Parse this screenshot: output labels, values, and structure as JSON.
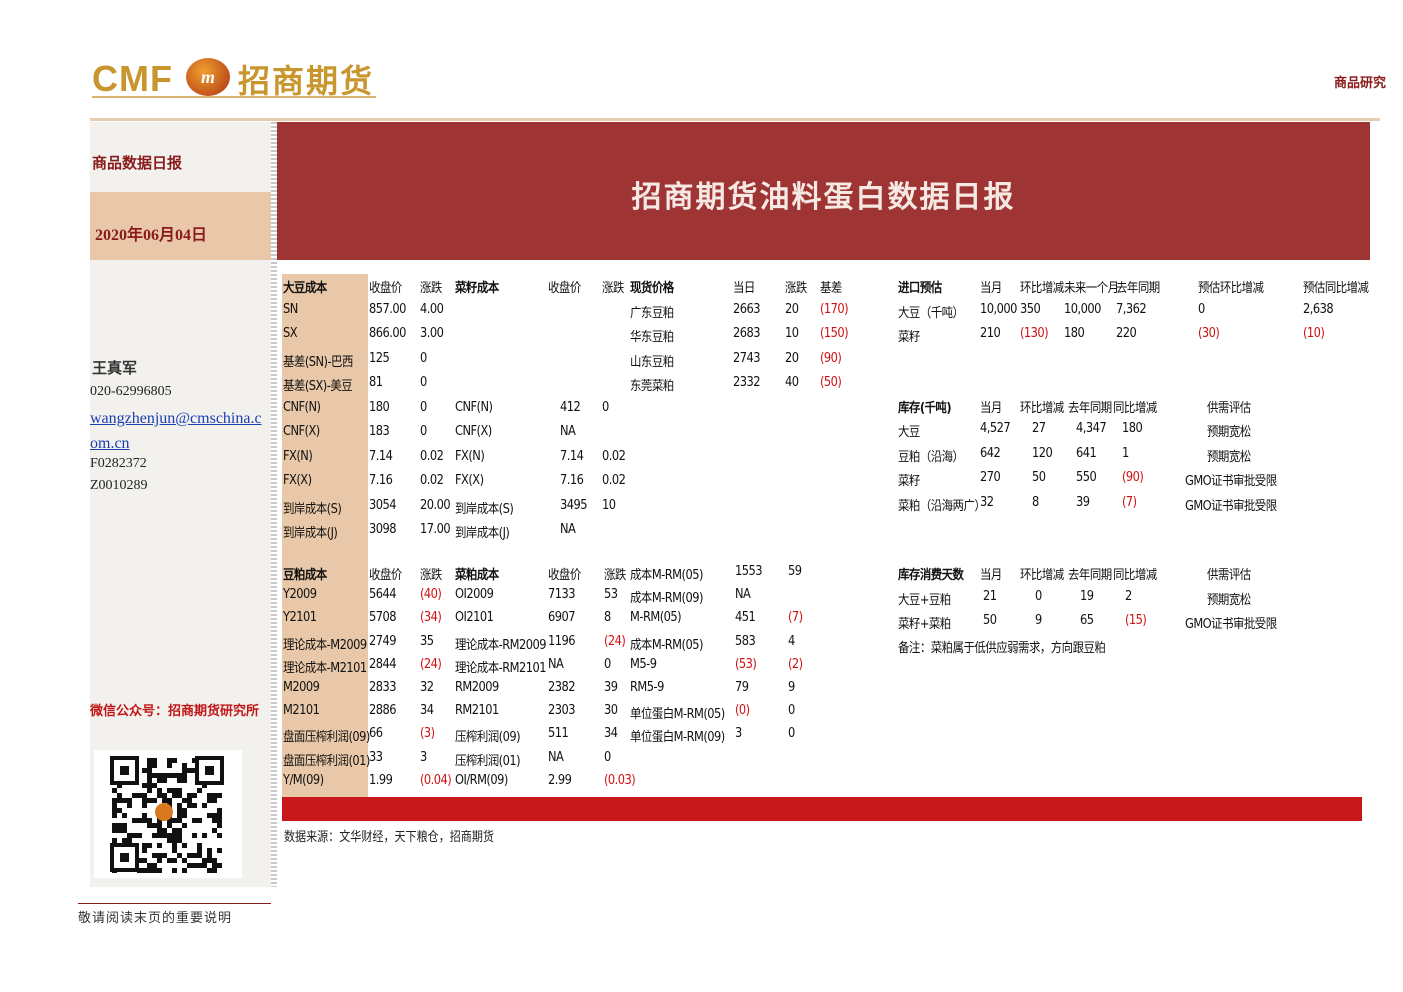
{
  "header": {
    "logo_latin": "CMF",
    "logo_chinese": "招商期货",
    "section": "商品研究"
  },
  "sidebar": {
    "report_type": "商品数据日报",
    "date": "2020年06月04日",
    "analyst_name": "王真军",
    "phone": "020-62996805",
    "email": "wangzhenjun@cmschina.com.cn",
    "license_1": "F0282372",
    "license_2": "Z0010289",
    "wechat": "微信公众号：招商期货研究所"
  },
  "banner": {
    "title": "招商期货油料蛋白数据日报"
  },
  "soy_cost": {
    "headers": [
      "大豆成本",
      "收盘价",
      "涨跌"
    ],
    "rows": [
      [
        "SN",
        "857.00",
        "4.00"
      ],
      [
        "SX",
        "866.00",
        "3.00"
      ],
      [
        "基差(SN)-巴西",
        "125",
        "0"
      ],
      [
        "基差(SX)-美豆",
        "81",
        "0"
      ],
      [
        "CNF(N)",
        "180",
        "0"
      ],
      [
        "CNF(X)",
        "183",
        "0"
      ],
      [
        "FX(N)",
        "7.14",
        "0.02"
      ],
      [
        "FX(X)",
        "7.16",
        "0.02"
      ],
      [
        "到岸成本(S)",
        "3054",
        "20.00"
      ],
      [
        "到岸成本(J)",
        "3098",
        "17.00"
      ]
    ]
  },
  "rapeseed_cost": {
    "headers": [
      "菜籽成本",
      "收盘价",
      "涨跌"
    ],
    "rows": [
      [
        "CNF(N)",
        "412",
        "0"
      ],
      [
        "CNF(X)",
        "NA",
        ""
      ],
      [
        "FX(N)",
        "7.14",
        "0.02"
      ],
      [
        "FX(X)",
        "7.16",
        "0.02"
      ],
      [
        "到岸成本(S)",
        "3495",
        "10"
      ],
      [
        "到岸成本(J)",
        "NA",
        ""
      ]
    ]
  },
  "spot_price": {
    "headers": [
      "现货价格",
      "当日",
      "涨跌",
      "基差"
    ],
    "rows": [
      [
        "广东豆粕",
        "2663",
        "20",
        "(170)"
      ],
      [
        "华东豆粕",
        "2683",
        "10",
        "(150)"
      ],
      [
        "山东豆粕",
        "2743",
        "20",
        "(90)"
      ],
      [
        "东莞菜粕",
        "2332",
        "40",
        "(50)"
      ]
    ]
  },
  "import_forecast": {
    "headers": [
      "进口预估",
      "当月",
      "环比增减",
      "未来一个月",
      "去年同期",
      "预估环比增减",
      "预估同比增减"
    ],
    "rows": [
      [
        "大豆（千吨）",
        "10,000",
        "350",
        "10,000",
        "7,362",
        "0",
        "2,638"
      ],
      [
        "菜籽",
        "210",
        "(130)",
        "180",
        "220",
        "(30)",
        "(10)"
      ]
    ]
  },
  "inventory": {
    "headers": [
      "库存(千吨)",
      "当月",
      "环比增减",
      "去年同期",
      "同比增减",
      "供需评估"
    ],
    "rows": [
      [
        "大豆",
        "4,527",
        "27",
        "4,347",
        "180",
        "GMO证书审批受限"
      ],
      [
        "豆粕（沿海）",
        "642",
        "120",
        "641",
        "1",
        "预期宽松"
      ],
      [
        "菜籽",
        "270",
        "50",
        "550",
        "(90)",
        "GMO证书审批受限"
      ],
      [
        "菜粕（沿海两广）",
        "32",
        "8",
        "39",
        "(7)",
        "GMO证书审批受限"
      ]
    ],
    "row_first_assess": "预期宽松"
  },
  "meal_cost": {
    "headers": [
      "豆粕成本",
      "收盘价",
      "涨跌"
    ],
    "rows": [
      [
        "Y2009",
        "5644",
        "(40)"
      ],
      [
        "Y2101",
        "5708",
        "(34)"
      ],
      [
        "理论成本-M2009",
        "2749",
        "35"
      ],
      [
        "理论成本-M2101",
        "2844",
        "(24)"
      ],
      [
        "M2009",
        "2833",
        "32"
      ],
      [
        "M2101",
        "2886",
        "34"
      ],
      [
        "盘面压榨利润(09)",
        "66",
        "(3)"
      ],
      [
        "盘面压榨利润(01)",
        "33",
        "3"
      ],
      [
        "Y/M(09)",
        "1.99",
        "(0.04)"
      ]
    ]
  },
  "rapemeal_cost": {
    "headers": [
      "菜粕成本",
      "收盘价",
      "涨跌"
    ],
    "rows": [
      [
        "OI2009",
        "7133",
        "53"
      ],
      [
        "OI2101",
        "6907",
        "8"
      ],
      [
        "理论成本-RM2009",
        "1196",
        "(24)"
      ],
      [
        "理论成本-RM2101",
        "NA",
        "0"
      ],
      [
        "RM2009",
        "2382",
        "39"
      ],
      [
        "RM2101",
        "2303",
        "30"
      ],
      [
        "压榨利润(09)",
        "511",
        "34"
      ],
      [
        "压榨利润(01)",
        "NA",
        "0"
      ],
      [
        "OI/RM(09)",
        "2.99",
        "(0.03)"
      ]
    ]
  },
  "spreads": {
    "rows": [
      [
        "成本M-RM(05)",
        "1553",
        "59"
      ],
      [
        "成本M-RM(09)",
        "NA",
        ""
      ],
      [
        "M-RM(05)",
        "451",
        "(7)"
      ],
      [
        "成本M-RM(05)",
        "583",
        "4"
      ],
      [
        "M5-9",
        "(53)",
        "(2)"
      ],
      [
        "RM5-9",
        "79",
        "9"
      ],
      [
        "单位蛋白M-RM(05)",
        "(0)",
        "0"
      ],
      [
        "单位蛋白M-RM(09)",
        "3",
        "0"
      ]
    ]
  },
  "consumption_days": {
    "headers": [
      "库存消费天数",
      "当月",
      "环比增减",
      "去年同期",
      "同比增减",
      "供需评估"
    ],
    "rows": [
      [
        "大豆+豆粕",
        "21",
        "0",
        "19",
        "2",
        "预期宽松"
      ],
      [
        "菜籽+菜粕",
        "50",
        "9",
        "65",
        "(15)",
        "GMO证书审批受限"
      ]
    ],
    "note": "备注：菜粕属于低供应弱需求，方向跟豆粕"
  },
  "source": "数据来源：文华财经，天下粮仓，招商期货",
  "footer": "敬请阅读末页的重要说明"
}
